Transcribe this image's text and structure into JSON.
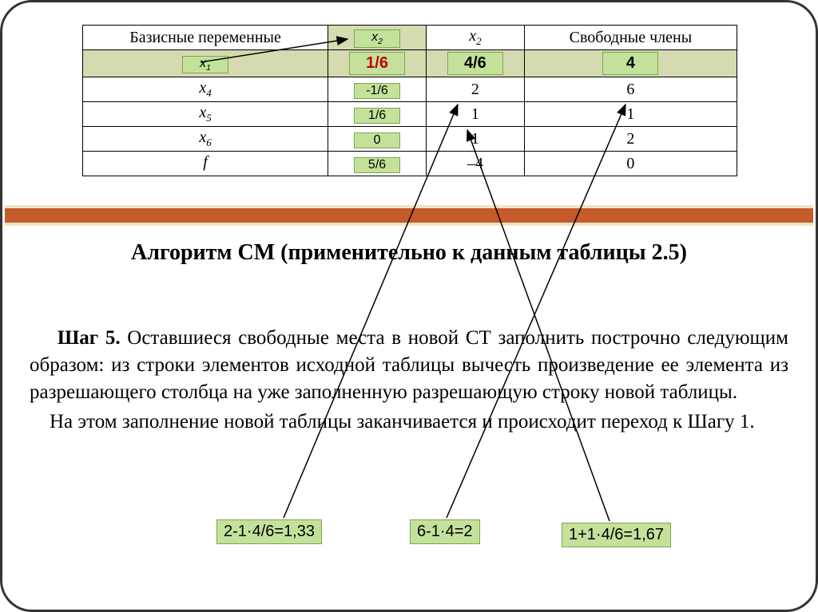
{
  "table": {
    "headers": {
      "basis": "Базисные переменные",
      "x2_boxed_label": "x",
      "x2_boxed_sub": "2",
      "x2_label": "x",
      "x2_sub": "2",
      "free": "Свободные члены"
    },
    "row1": {
      "basis_label": "x",
      "basis_sub": "1",
      "col1": "1/6",
      "col2": "4/6",
      "free": "4"
    },
    "rows": [
      {
        "basis_label": "x",
        "basis_sub": "4",
        "col1": "-1/6",
        "col2": "2",
        "free": "6"
      },
      {
        "basis_label": "x",
        "basis_sub": "5",
        "col1": "1/6",
        "col2": "1",
        "free": "1"
      },
      {
        "basis_label": "x",
        "basis_sub": "6",
        "col1": "0",
        "col2": "1",
        "free": "2"
      },
      {
        "basis_label": "f",
        "basis_sub": "",
        "col1": "5/6",
        "col2": "–4",
        "free": "0"
      }
    ]
  },
  "heading": "Алгоритм СМ (применительно к данным таблицы 2.5)",
  "step_label": "Шаг 5.",
  "paragraph1": " Оставшиеся свободные места в новой СТ заполнить по­строчно следующим образом: из строки элементов исходной таблицы вычесть произведение ее элемента из разрешающего столбца на уже за­полненную разрешающую строку новой таблицы.",
  "paragraph2": "На этом заполнение новой таблицы заканчивается и происходит переход к Шагу 1.",
  "calcs": {
    "c1": "2-1·4/6=1,33",
    "c2": "6-1·4=2",
    "c3": "1+1·4/6=1,67"
  }
}
